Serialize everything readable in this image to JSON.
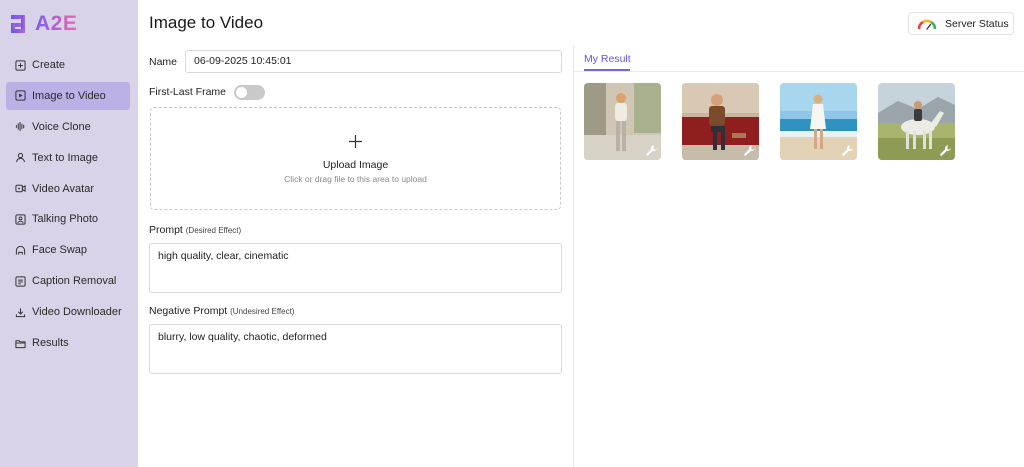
{
  "brand": {
    "logo_text": "A2E",
    "accent": "#7a63e0"
  },
  "sidebar": {
    "items": [
      {
        "label": "Create",
        "icon": "plus-square-icon",
        "active": false
      },
      {
        "label": "Image to Video",
        "icon": "image-play-icon",
        "active": true
      },
      {
        "label": "Voice Clone",
        "icon": "waveform-icon",
        "active": false
      },
      {
        "label": "Text to Image",
        "icon": "person-icon",
        "active": false
      },
      {
        "label": "Video Avatar",
        "icon": "video-camera-icon",
        "active": false
      },
      {
        "label": "Talking Photo",
        "icon": "portrait-icon",
        "active": false
      },
      {
        "label": "Face Swap",
        "icon": "face-swap-icon",
        "active": false
      },
      {
        "label": "Caption Removal",
        "icon": "caption-icon",
        "active": false
      },
      {
        "label": "Video Downloader",
        "icon": "download-icon",
        "active": false
      },
      {
        "label": "Results",
        "icon": "folder-icon",
        "active": false
      }
    ]
  },
  "header": {
    "title": "Image to Video",
    "server_status_label": "Server Status"
  },
  "form": {
    "name_label": "Name",
    "name_value": "06-09-2025 10:45:01",
    "first_last_label": "First-Last Frame",
    "first_last_enabled": false,
    "upload_title": "Upload Image",
    "upload_hint": "Click or drag file to this area to upload",
    "prompt_label": "Prompt",
    "prompt_hint": "(Desired Effect)",
    "prompt_value": "high quality, clear, cinematic",
    "negative_label": "Negative Prompt",
    "negative_hint": "(Undesired Effect)",
    "negative_value": "blurry, low quality, chaotic, deformed"
  },
  "results": {
    "tab_label": "My Result",
    "items": [
      {
        "scene": "woman-street-thumbnail",
        "action_icon": "wrench-icon"
      },
      {
        "scene": "man-sofa-thumbnail",
        "action_icon": "wrench-icon"
      },
      {
        "scene": "woman-beach-thumbnail",
        "action_icon": "wrench-icon"
      },
      {
        "scene": "rider-horse-thumbnail",
        "action_icon": "wrench-icon"
      }
    ]
  }
}
